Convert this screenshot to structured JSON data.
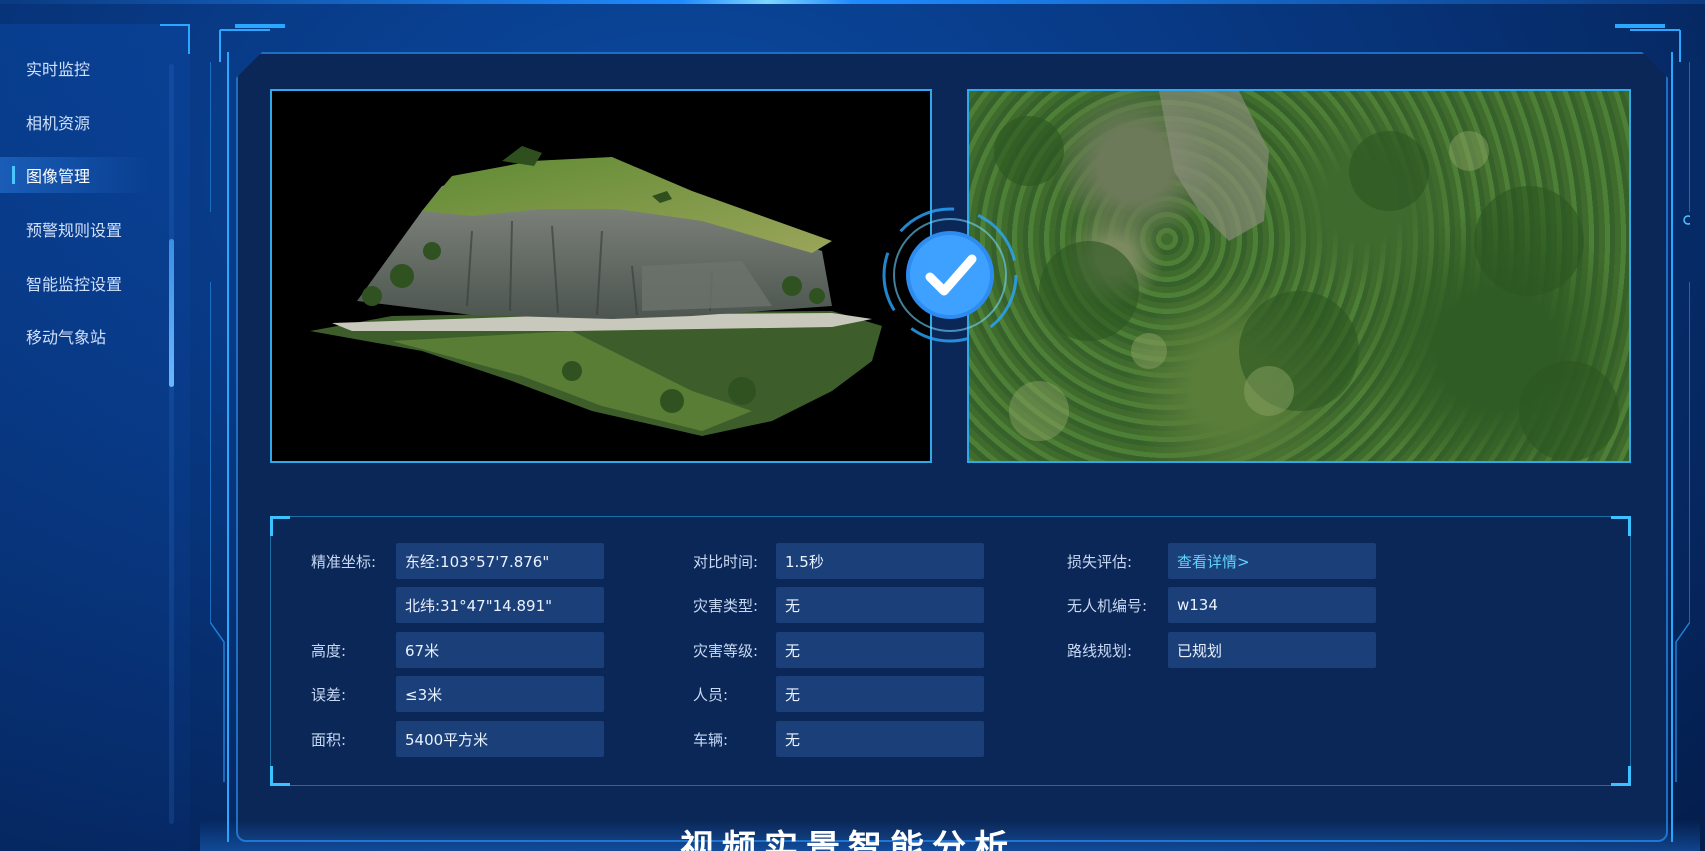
{
  "sidebar": {
    "items": [
      {
        "label": "实时监控",
        "active": false
      },
      {
        "label": "相机资源",
        "active": false
      },
      {
        "label": "图像管理",
        "active": true
      },
      {
        "label": "预警规则设置",
        "active": false
      },
      {
        "label": "智能监控设置",
        "active": false
      },
      {
        "label": "移动气象站",
        "active": false
      }
    ]
  },
  "info": {
    "coord_label": "精准坐标:",
    "coord_lon": "东经:103°57'7.876\"",
    "coord_lat": "北纬:31°47\"14.891\"",
    "height_label": "高度:",
    "height_value": "67米",
    "error_label": "误差:",
    "error_value": "≤3米",
    "area_label": "面积:",
    "area_value": "5400平方米",
    "compare_time_label": "对比时间:",
    "compare_time_value": "1.5秒",
    "disaster_type_label": "灾害类型:",
    "disaster_type_value": "无",
    "disaster_level_label": "灾害等级:",
    "disaster_level_value": "无",
    "personnel_label": "人员:",
    "personnel_value": "无",
    "vehicle_label": "车辆:",
    "vehicle_value": "无",
    "loss_label": "损失评估:",
    "loss_value": "查看详情>",
    "drone_label": "无人机编号:",
    "drone_value": "w134",
    "route_label": "路线规划:",
    "route_value": "已规划"
  },
  "bottom_title": "视频实景智能分析",
  "colors": {
    "accent": "#2fa9e8",
    "panel": "#0a2758",
    "value_bg": "#1b3f78",
    "link": "#5fd4ff"
  }
}
